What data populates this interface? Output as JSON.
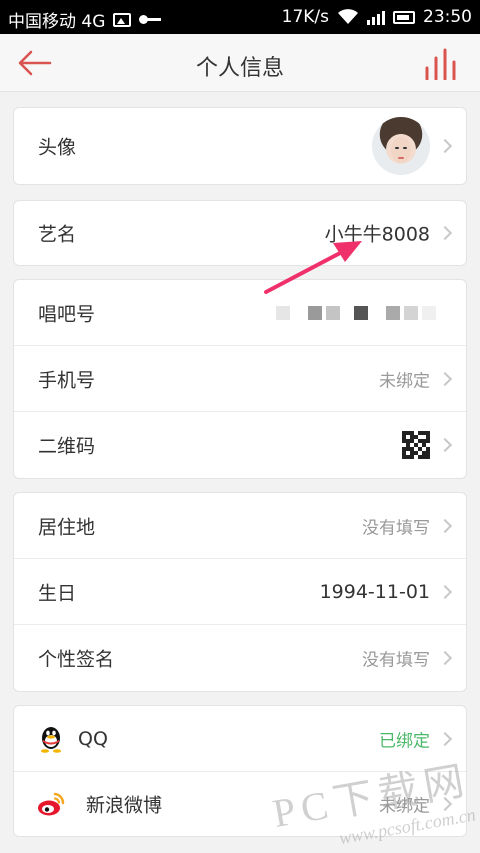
{
  "status_bar": {
    "carrier": "中国移动 4G",
    "speed": "17K/s",
    "time": "23:50",
    "icons": [
      "image-icon",
      "key-icon",
      "wifi-icon",
      "signal-icon",
      "battery-icon"
    ]
  },
  "nav": {
    "title": "个人信息",
    "back_icon": "arrow-left-icon",
    "equalizer_icon": "equalizer-icon",
    "accent": "#d9534f"
  },
  "rows": {
    "avatar": {
      "label": "头像"
    },
    "stage_name": {
      "label": "艺名",
      "value": "小牛牛8008"
    },
    "changba_id": {
      "label": "唱吧号"
    },
    "phone": {
      "label": "手机号",
      "value": "未绑定"
    },
    "qrcode": {
      "label": "二维码"
    },
    "residence": {
      "label": "居住地",
      "value": "没有填写"
    },
    "birthday": {
      "label": "生日",
      "value": "1994-11-01"
    },
    "signature": {
      "label": "个性签名",
      "value": "没有填写"
    },
    "qq": {
      "label": "QQ",
      "value": "已绑定",
      "icon": "qq-penguin-icon"
    },
    "weibo": {
      "label": "新浪微博",
      "value": "未绑定",
      "icon": "weibo-icon"
    }
  },
  "watermark": {
    "title": "PC下载网",
    "url": "www.pcsoft.com.cn"
  },
  "colors": {
    "green_status": "#4cb86a",
    "annotation_arrow": "#f0306a"
  }
}
